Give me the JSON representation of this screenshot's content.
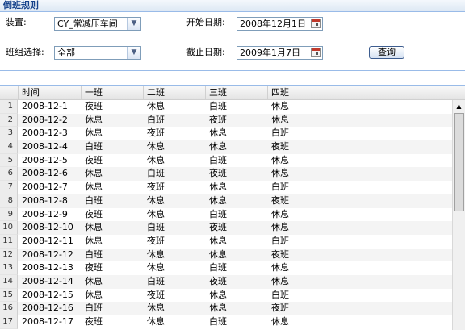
{
  "panel_title": "倒班规则",
  "filters": {
    "device_label": "装置:",
    "device_value": "CY_常减压车间",
    "group_label": "班组选择:",
    "group_value": "全部",
    "start_label": "开始日期:",
    "start_value": "2008年12月1日",
    "end_label": "截止日期:",
    "end_value": "2009年1月7日",
    "query_label": "查询"
  },
  "grid": {
    "columns": [
      "时间",
      "一班",
      "二班",
      "三班",
      "四班"
    ],
    "rows": [
      {
        "n": "1",
        "date": "2008-12-1",
        "c1": "夜班",
        "c2": "休息",
        "c3": "白班",
        "c4": "休息"
      },
      {
        "n": "2",
        "date": "2008-12-2",
        "c1": "休息",
        "c2": "白班",
        "c3": "夜班",
        "c4": "休息"
      },
      {
        "n": "3",
        "date": "2008-12-3",
        "c1": "休息",
        "c2": "夜班",
        "c3": "休息",
        "c4": "白班"
      },
      {
        "n": "4",
        "date": "2008-12-4",
        "c1": "白班",
        "c2": "休息",
        "c3": "休息",
        "c4": "夜班"
      },
      {
        "n": "5",
        "date": "2008-12-5",
        "c1": "夜班",
        "c2": "休息",
        "c3": "白班",
        "c4": "休息"
      },
      {
        "n": "6",
        "date": "2008-12-6",
        "c1": "休息",
        "c2": "白班",
        "c3": "夜班",
        "c4": "休息"
      },
      {
        "n": "7",
        "date": "2008-12-7",
        "c1": "休息",
        "c2": "夜班",
        "c3": "休息",
        "c4": "白班"
      },
      {
        "n": "8",
        "date": "2008-12-8",
        "c1": "白班",
        "c2": "休息",
        "c3": "休息",
        "c4": "夜班"
      },
      {
        "n": "9",
        "date": "2008-12-9",
        "c1": "夜班",
        "c2": "休息",
        "c3": "白班",
        "c4": "休息"
      },
      {
        "n": "10",
        "date": "2008-12-10",
        "c1": "休息",
        "c2": "白班",
        "c3": "夜班",
        "c4": "休息"
      },
      {
        "n": "11",
        "date": "2008-12-11",
        "c1": "休息",
        "c2": "夜班",
        "c3": "休息",
        "c4": "白班"
      },
      {
        "n": "12",
        "date": "2008-12-12",
        "c1": "白班",
        "c2": "休息",
        "c3": "休息",
        "c4": "夜班"
      },
      {
        "n": "13",
        "date": "2008-12-13",
        "c1": "夜班",
        "c2": "休息",
        "c3": "白班",
        "c4": "休息"
      },
      {
        "n": "14",
        "date": "2008-12-14",
        "c1": "休息",
        "c2": "白班",
        "c3": "夜班",
        "c4": "休息"
      },
      {
        "n": "15",
        "date": "2008-12-15",
        "c1": "休息",
        "c2": "夜班",
        "c3": "休息",
        "c4": "白班"
      },
      {
        "n": "16",
        "date": "2008-12-16",
        "c1": "白班",
        "c2": "休息",
        "c3": "休息",
        "c4": "夜班"
      },
      {
        "n": "17",
        "date": "2008-12-17",
        "c1": "夜班",
        "c2": "休息",
        "c3": "白班",
        "c4": "休息"
      }
    ]
  },
  "icons": {
    "combo_arrow": "chevron-down-icon",
    "calendar": "calendar-icon",
    "scroll_up": "scroll-up-icon"
  }
}
